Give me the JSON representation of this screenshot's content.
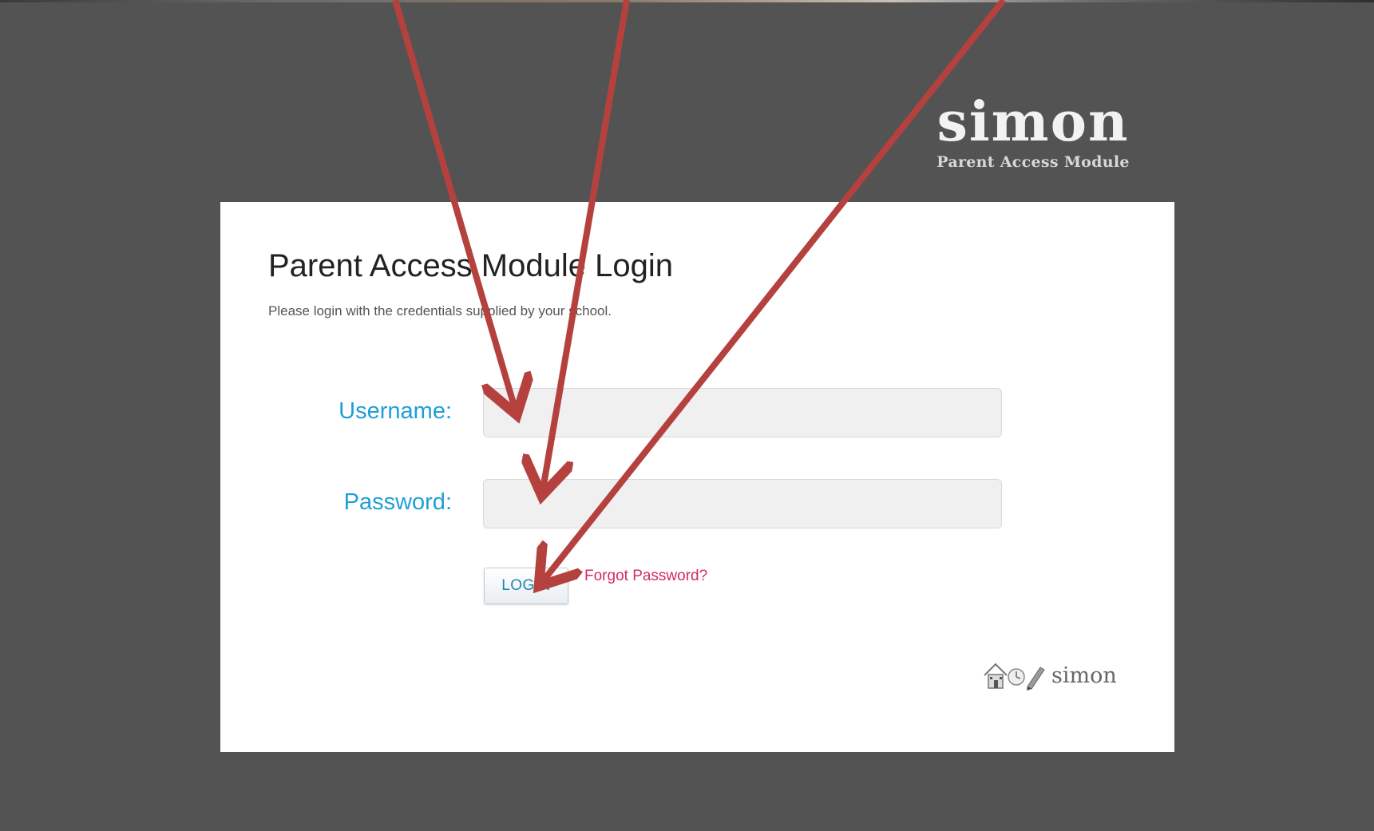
{
  "brand": {
    "name": "simon",
    "tagline": "Parent Access Module"
  },
  "login_card": {
    "title": "Parent Access Module Login",
    "subtitle": "Please login with the credentials supplied by your school.",
    "username_label": "Username:",
    "username_value": "",
    "password_label": "Password:",
    "password_value": "",
    "login_button_label": "LOGIN",
    "forgot_password_label": "Forgot Password?"
  },
  "footer": {
    "logo_text": "simon"
  },
  "annotations": {
    "arrow_color": "#b5413f",
    "count": 3
  }
}
